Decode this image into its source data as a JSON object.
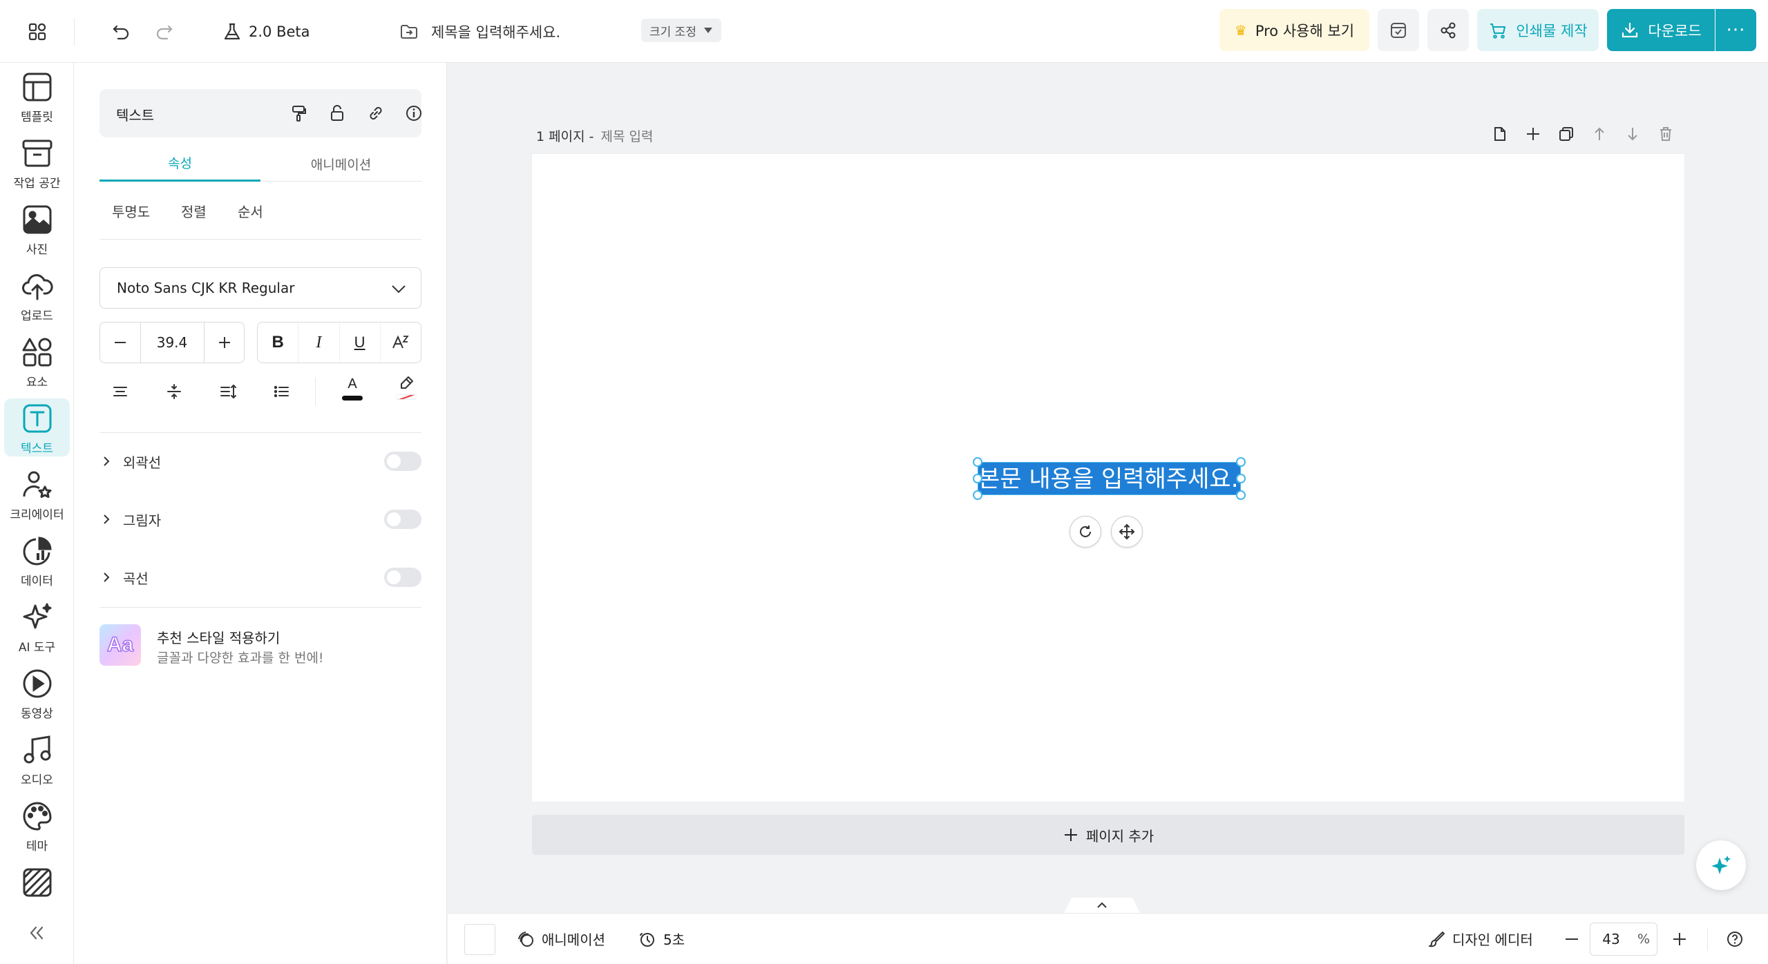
{
  "topbar": {
    "version_label": "2.0 Beta",
    "doc_title_placeholder": "제목을 입력해주세요.",
    "resize_label": "크기 조정",
    "pro_label": "Pro 사용해 보기",
    "print_label": "인쇄물 제작",
    "download_label": "다운로드"
  },
  "rail": {
    "items": [
      {
        "label": "템플릿",
        "icon": "template-icon"
      },
      {
        "label": "작업 공간",
        "icon": "archive-icon"
      },
      {
        "label": "사진",
        "icon": "photo-icon"
      },
      {
        "label": "업로드",
        "icon": "cloud-upload-icon"
      },
      {
        "label": "요소",
        "icon": "shapes-icon"
      },
      {
        "label": "텍스트",
        "icon": "text-icon"
      },
      {
        "label": "크리에이터",
        "icon": "creator-icon"
      },
      {
        "label": "데이터",
        "icon": "chart-icon"
      },
      {
        "label": "AI 도구",
        "icon": "sparkle-icon"
      },
      {
        "label": "동영상",
        "icon": "play-icon"
      },
      {
        "label": "오디오",
        "icon": "music-icon"
      },
      {
        "label": "테마",
        "icon": "palette-icon"
      }
    ],
    "active_index": 5
  },
  "panel": {
    "title": "텍스트",
    "tabs": [
      "속성",
      "애니메이션"
    ],
    "subtabs": [
      "투명도",
      "정렬",
      "순서"
    ],
    "font_name": "Noto Sans CJK KR Regular",
    "font_size": "39.4",
    "style_buttons": [
      "B",
      "I",
      "U"
    ],
    "sections": [
      "외곽선",
      "그림자",
      "곡선"
    ],
    "recommend": {
      "badge": "Aa",
      "title": "추천 스타일 적용하기",
      "subtitle": "글꼴과 다양한 효과를 한 번에!"
    }
  },
  "canvas": {
    "page_number_label": "1 페이지 -",
    "page_title_placeholder": "제목 입력",
    "body_text": "본문 내용을 입력해주세요.",
    "add_page_label": "페이지 추가"
  },
  "bottombar": {
    "animation_label": "애니메이션",
    "duration_label": "5초",
    "design_editor_label": "디자인 에디터",
    "zoom_value": "43",
    "zoom_unit": "%"
  },
  "colors": {
    "accent": "#0aa7b8",
    "download_bg": "#12a4b7",
    "selection_bg": "#1f7fd6",
    "pro_bg": "#fff8e0",
    "print_bg": "#e3f4f6"
  }
}
